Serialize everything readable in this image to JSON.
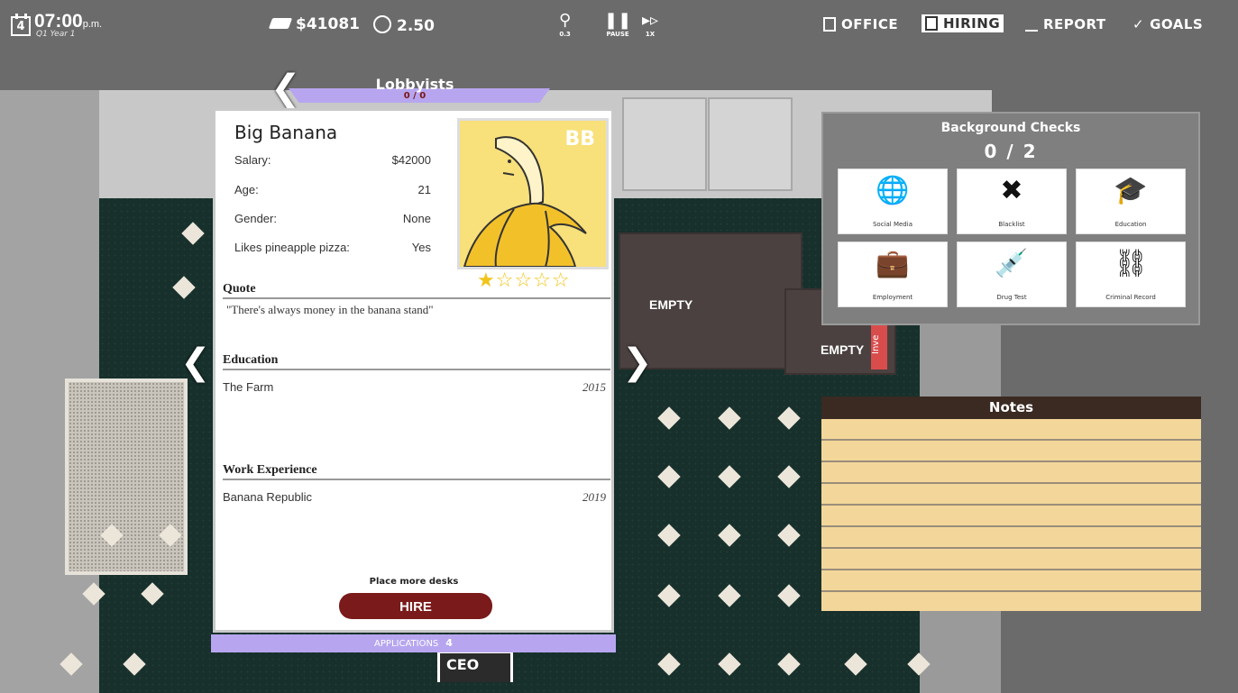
{
  "topbar": {
    "day": "4",
    "time": "07:00",
    "ampm": "p.m.",
    "quarter": "Q1 Year 1",
    "money": "$41081",
    "rating": "2.50",
    "zoom": "0.3",
    "pause_label": "PAUSE",
    "speed_label": "1X",
    "nav": [
      {
        "label": "OFFICE",
        "active": false
      },
      {
        "label": "HIRING",
        "active": true
      },
      {
        "label": "REPORT",
        "active": false
      },
      {
        "label": "GOALS",
        "active": false
      }
    ]
  },
  "office": {
    "desk_labels": [
      "EMPTY",
      "EMPTY"
    ],
    "tag": "Inve",
    "ceo_label": "CEO"
  },
  "hiring": {
    "category": "Lobbyists",
    "category_count": "0 / 0",
    "candidate": {
      "name": "Big Banana",
      "initials": "BB",
      "stats": [
        {
          "label": "Salary:",
          "value": "$42000"
        },
        {
          "label": "Age:",
          "value": "21"
        },
        {
          "label": "Gender:",
          "value": "None"
        },
        {
          "label": "Likes pineapple pizza:",
          "value": "Yes"
        }
      ],
      "rating_stars": 1,
      "rating_max": 5,
      "stars_text": "★☆☆☆☆",
      "quote_heading": "Quote",
      "quote": "\"There's always money in the banana stand\"",
      "education_heading": "Education",
      "education": [
        {
          "name": "The Farm",
          "year": "2015"
        }
      ],
      "work_heading": "Work Experience",
      "work": [
        {
          "name": "Banana Republic",
          "year": "2019"
        }
      ]
    },
    "place_note": "Place more desks",
    "hire_label": "HIRE",
    "applications_label": "APPLICATIONS",
    "applications_count": "4"
  },
  "background_checks": {
    "title": "Background Checks",
    "count": "0 / 2",
    "items": [
      {
        "label": "Social Media",
        "icon": "globe-cursor-icon",
        "glyph": "🌐"
      },
      {
        "label": "Blacklist",
        "icon": "blacklist-icon",
        "glyph": "✖"
      },
      {
        "label": "Education",
        "icon": "graduation-cap-icon",
        "glyph": "🎓"
      },
      {
        "label": "Employment",
        "icon": "briefcase-icon",
        "glyph": "💼"
      },
      {
        "label": "Drug Test",
        "icon": "syringe-icon",
        "glyph": "💉"
      },
      {
        "label": "Criminal Record",
        "icon": "handcuffs-icon",
        "glyph": "⛓"
      }
    ]
  },
  "notes": {
    "title": "Notes"
  }
}
